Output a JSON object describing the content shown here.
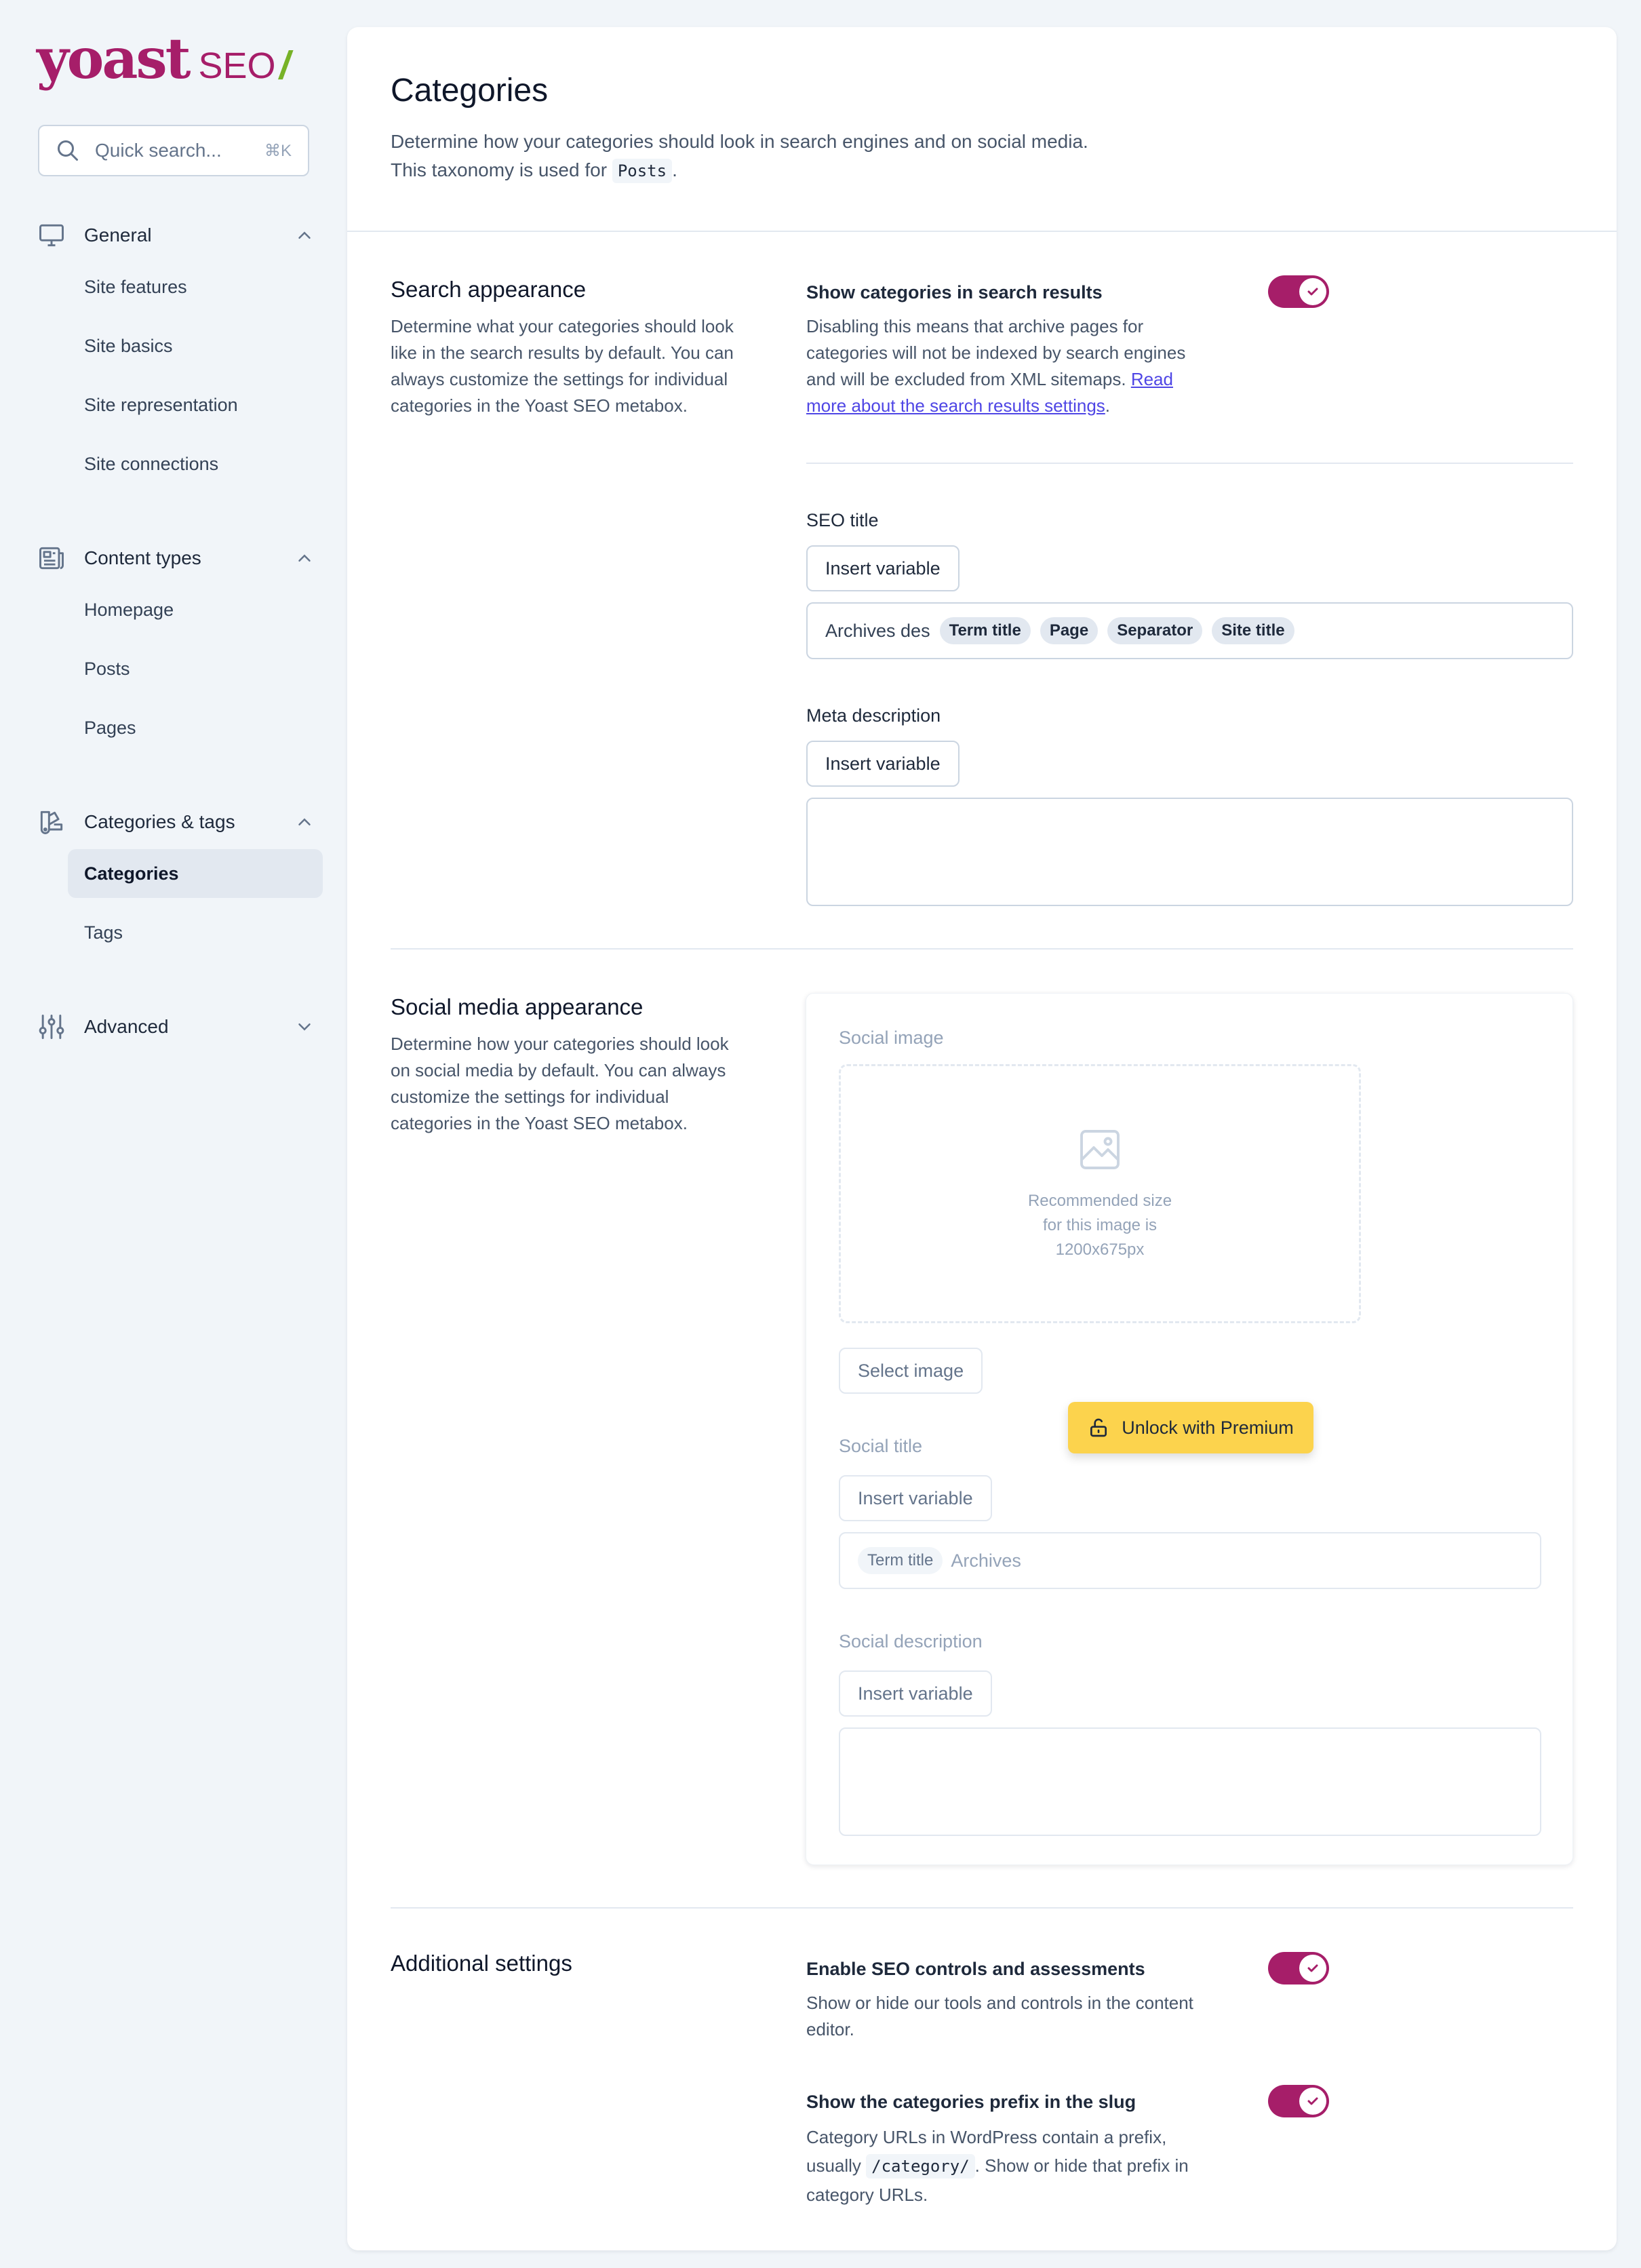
{
  "brand": {
    "name": "yoast",
    "product": "SEO",
    "slash": "/",
    "primary_color": "#a61e69",
    "accent_color": "#77b227"
  },
  "search": {
    "placeholder": "Quick search...",
    "shortcut": "⌘K"
  },
  "sidebar": {
    "groups": [
      {
        "label": "General",
        "icon": "monitor-icon",
        "expanded": true,
        "items": [
          "Site features",
          "Site basics",
          "Site representation",
          "Site connections"
        ]
      },
      {
        "label": "Content types",
        "icon": "newspaper-icon",
        "expanded": true,
        "items": [
          "Homepage",
          "Posts",
          "Pages"
        ]
      },
      {
        "label": "Categories & tags",
        "icon": "color-swatch-icon",
        "expanded": true,
        "items": [
          "Categories",
          "Tags"
        ],
        "active": "Categories"
      },
      {
        "label": "Advanced",
        "icon": "adjustments-icon",
        "expanded": false,
        "items": []
      }
    ]
  },
  "header": {
    "title": "Categories",
    "desc_line1": "Determine how your categories should look in search engines and on social media.",
    "desc_line2_prefix": "This taxonomy is used for ",
    "desc_line2_code": "Posts",
    "desc_line2_suffix": "."
  },
  "search_appearance": {
    "title": "Search appearance",
    "desc": "Determine what your categories should look like in the search results by default. You can always customize the settings for individual categories in the Yoast SEO metabox.",
    "toggle_label": "Show categories in search results",
    "toggle_on": true,
    "toggle_help": "Disabling this means that archive pages for categories will not be indexed by search engines and will be excluded from XML sitemaps. ",
    "toggle_link": "Read more about the search results settings",
    "toggle_help_end": ".",
    "seo_title_label": "SEO title",
    "insert_variable": "Insert variable",
    "seo_title_text": "Archives des",
    "seo_title_pills": [
      "Term title",
      "Page",
      "Separator",
      "Site title"
    ],
    "meta_desc_label": "Meta description",
    "meta_desc_value": ""
  },
  "social_appearance": {
    "title": "Social media appearance",
    "desc": "Determine how your categories should look on social media by default. You can always customize the settings for individual categories in the Yoast SEO metabox.",
    "image_label": "Social image",
    "image_rec_1": "Recommended size",
    "image_rec_2": "for this image is",
    "image_rec_3": "1200x675px",
    "select_image": "Select image",
    "unlock": "Unlock with Premium",
    "social_title_label": "Social title",
    "insert_variable": "Insert variable",
    "social_title_pill": "Term title",
    "social_title_text": "Archives",
    "social_desc_label": "Social description",
    "social_desc_value": ""
  },
  "additional": {
    "title": "Additional settings",
    "seo_controls_label": "Enable SEO controls and assessments",
    "seo_controls_on": true,
    "seo_controls_help": "Show or hide our tools and controls in the content editor.",
    "prefix_label": "Show the categories prefix in the slug",
    "prefix_on": true,
    "prefix_help_1": "Category URLs in WordPress contain a prefix,",
    "prefix_help_2a": "usually ",
    "prefix_help_code": "/category/",
    "prefix_help_2b": ". Show or hide that prefix in",
    "prefix_help_3": "category URLs."
  }
}
